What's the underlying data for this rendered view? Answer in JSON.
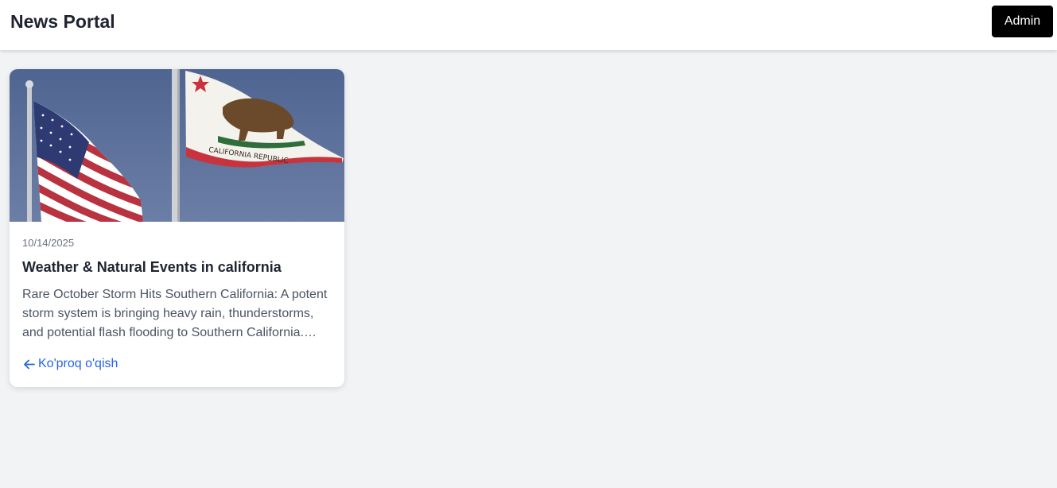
{
  "header": {
    "site_title": "News Portal",
    "admin_label": "Admin"
  },
  "articles": [
    {
      "image_icon": "flags-photo",
      "date": "10/14/2025",
      "title": "Weather & Natural Events in california",
      "excerpt": "Rare October Storm Hits Southern California: A potent storm system is bringing heavy rain, thunderstorms, and potential flash flooding to Southern California. Residents are urged to prepare.",
      "flag_text": "CALIFORNIA REPUBLIC",
      "read_more_label": "Ko'proq o'qish",
      "read_more_icon": "arrow-left-icon"
    }
  ],
  "colors": {
    "page_bg": "#f2f3f5",
    "admin_bg": "#000000",
    "link": "#2563eb",
    "sky": "#5b6f98"
  }
}
